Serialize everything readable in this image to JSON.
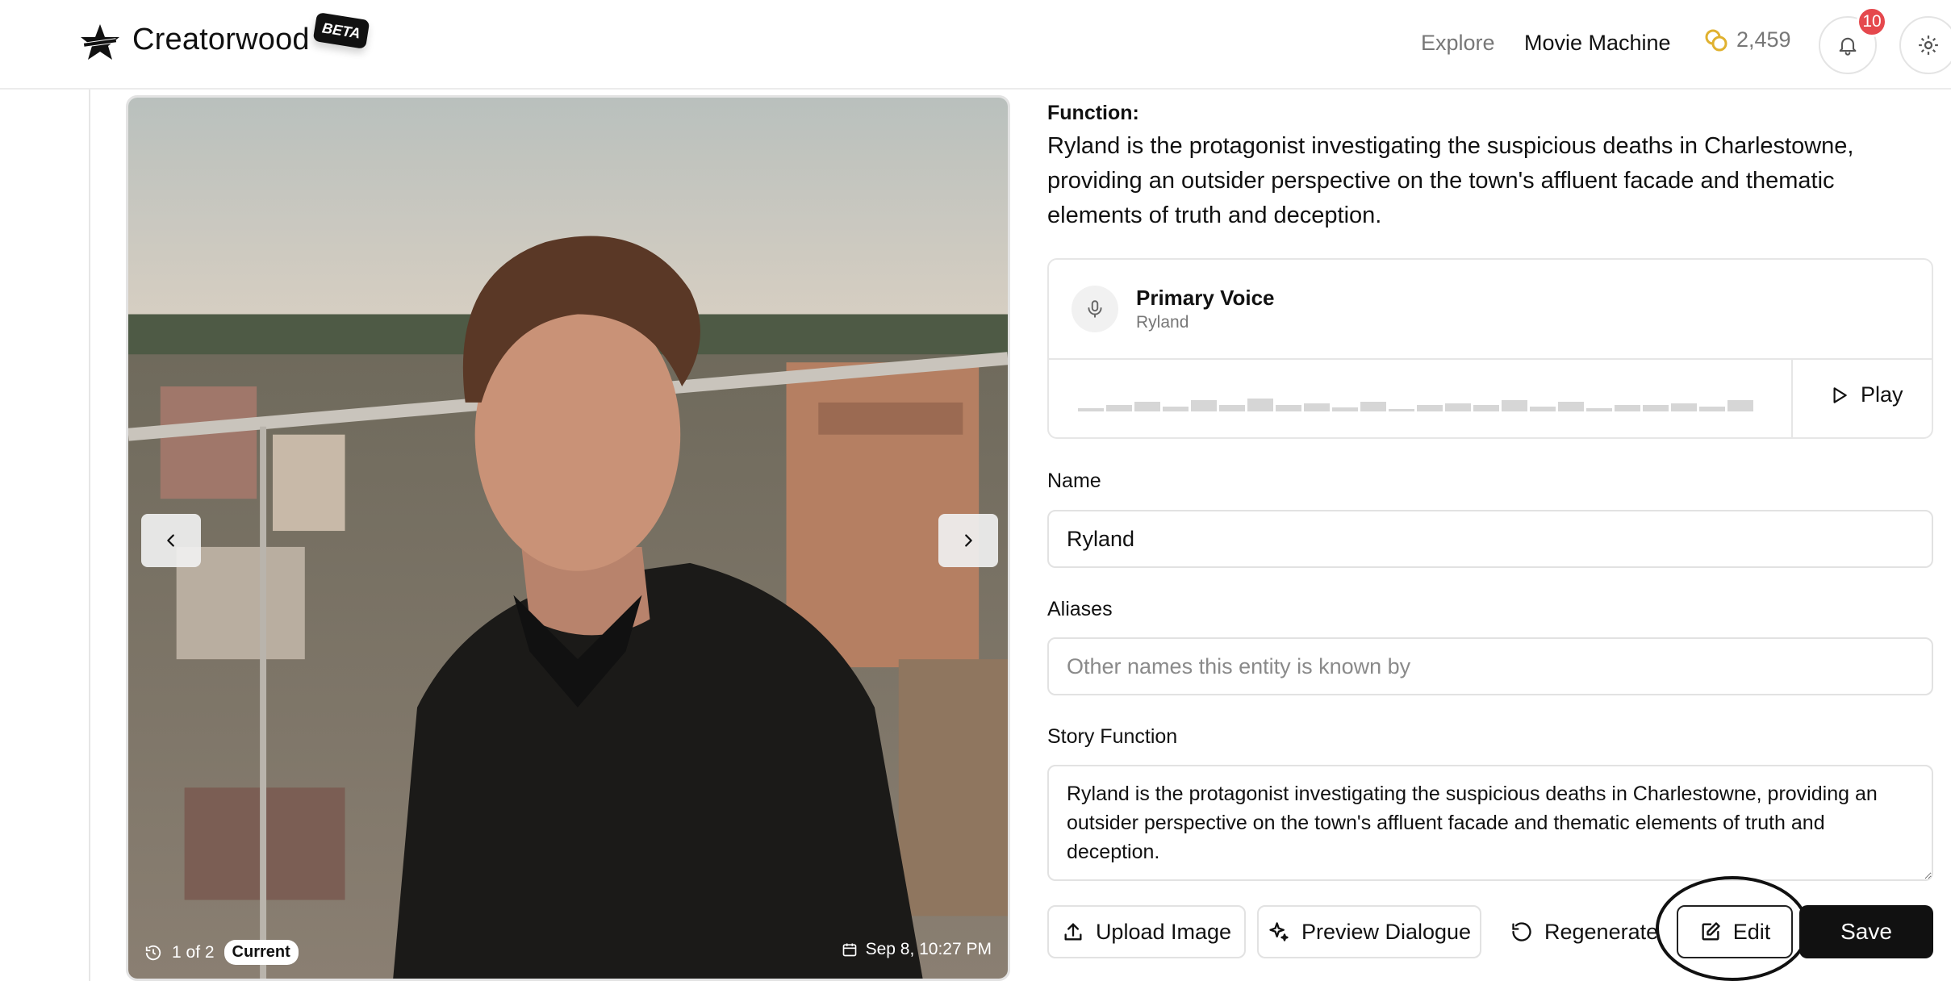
{
  "header": {
    "brand": "Creatorwood",
    "beta_badge": "BETA",
    "nav": {
      "explore": "Explore",
      "movie_machine": "Movie Machine"
    },
    "credits": "2,459",
    "notifications_count": "10",
    "colors": {
      "badge": "#e5484d",
      "coin": "#e0b12f"
    }
  },
  "gallery": {
    "counter": "1 of 2",
    "status": "Current",
    "date": "Sep 8, 10:27 PM"
  },
  "details": {
    "function_label": "Function:",
    "function_text": "Ryland is the protagonist investigating the suspicious deaths in Charlestowne, providing an outsider perspective on the town's affluent facade and thematic elements of truth and deception.",
    "voice": {
      "title": "Primary Voice",
      "name": "Ryland",
      "play_label": "Play"
    },
    "name_label": "Name",
    "name_value": "Ryland",
    "aliases_label": "Aliases",
    "aliases_placeholder": "Other names this entity is known by",
    "story_label": "Story Function",
    "story_value": "Ryland is the protagonist investigating the suspicious deaths in Charlestowne, providing an outsider perspective on the town's affluent facade and thematic elements of truth and deception."
  },
  "actions": {
    "upload": "Upload Image",
    "preview": "Preview Dialogue",
    "regenerate": "Regenerate",
    "edit": "Edit",
    "save": "Save"
  }
}
